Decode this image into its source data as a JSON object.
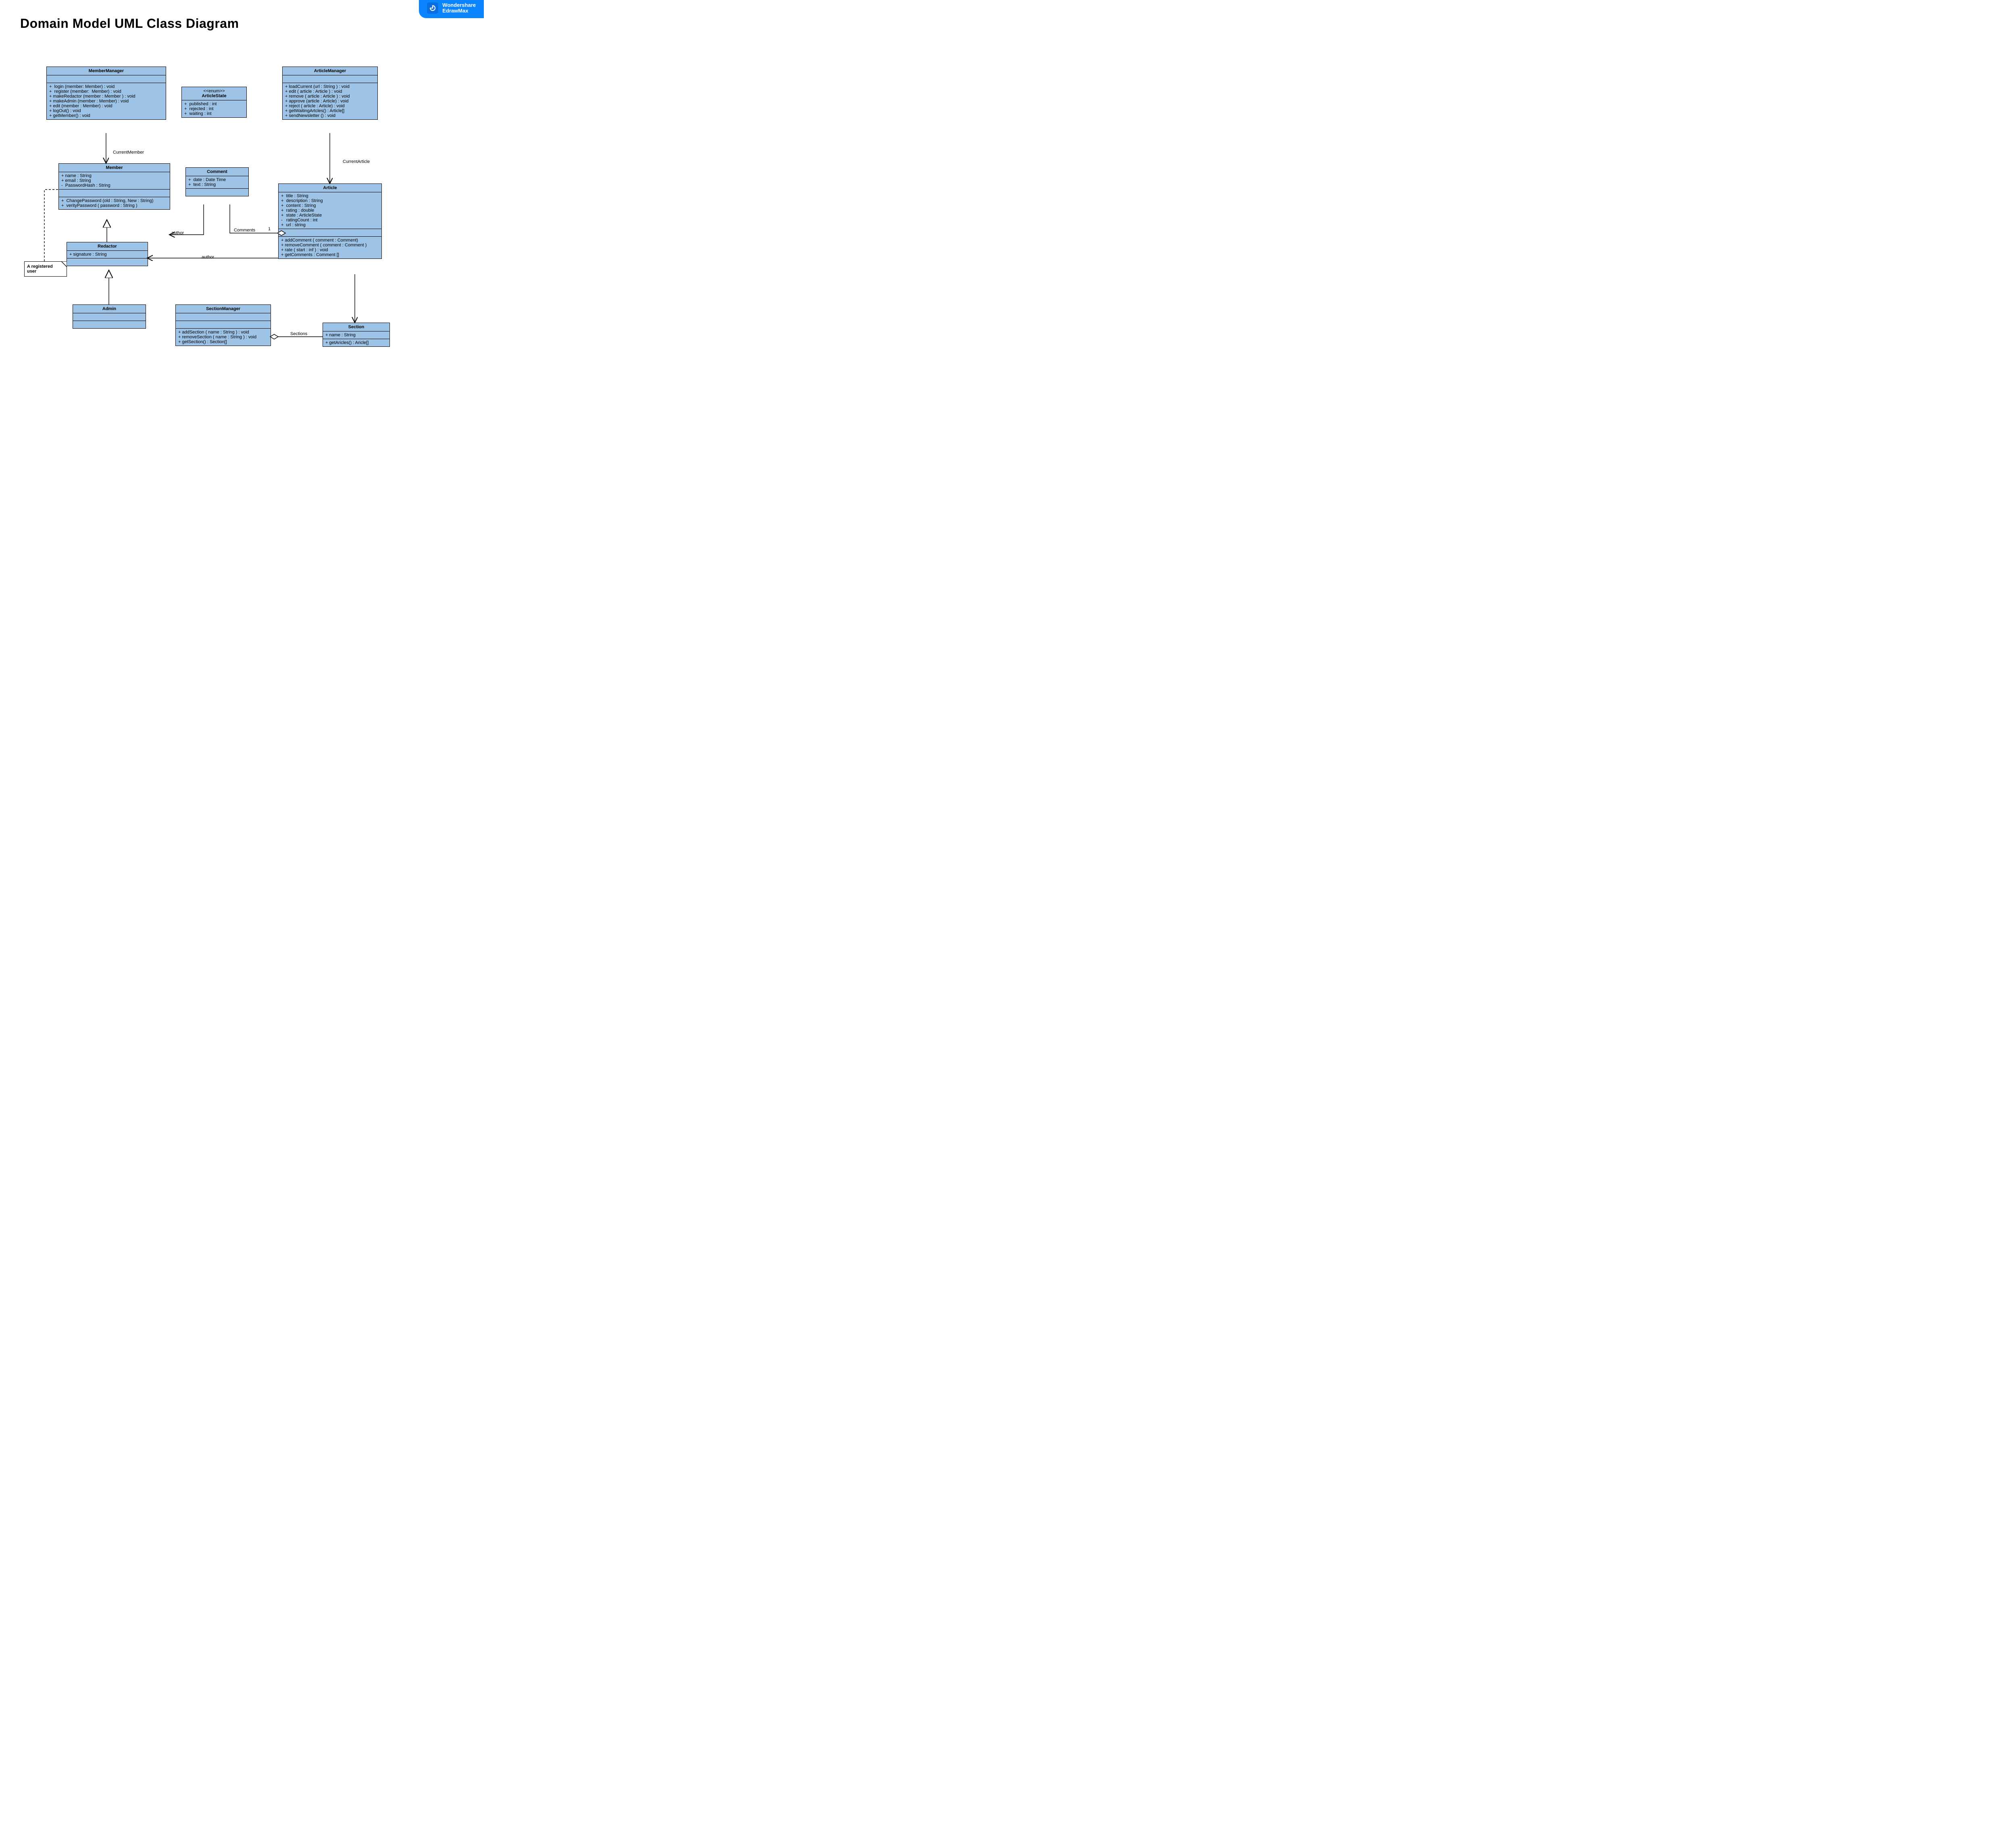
{
  "title": "Domain Model UML Class Diagram",
  "brand": {
    "line1": "Wondershare",
    "line2": "EdrawMax"
  },
  "note": {
    "text": "A registered user"
  },
  "labels": {
    "currentMember": "CurrentMember",
    "currentArticle": "CurrentArticle",
    "author1": "author",
    "author2": "author",
    "comments": "Comments",
    "one": "1",
    "sections": "Sections"
  },
  "classes": {
    "memberManager": {
      "name": "MemberManager",
      "attrs": [],
      "ops": [
        "+  login (member: Member) : void",
        "+  register (member:  Member) : void",
        "+ makeRedactor (member : Member ) : void",
        "+ makeAdmin (member : Member) : void",
        "+ edit (member : Member) : void",
        "+ logOut() : void",
        "+ getMember() : void"
      ]
    },
    "articleState": {
      "stereo": "<<enum>>",
      "name": "ArticleState",
      "attrs": [
        "+  published : int",
        "+  rejected : int",
        "+  waiting : int"
      ]
    },
    "articleManager": {
      "name": "ArticleManager",
      "attrs": [],
      "ops": [
        "+ loadCurrent (url : String ) : void",
        "+ edit ( article : Article ) : void",
        "+ remove ( article : Article ) : void",
        "+ approve (article : Article) : void",
        "+ reject ( article : Article) : void",
        "+ getWaitingArtcles() : Article[]",
        "+ sendNewsletter () : void"
      ]
    },
    "member": {
      "name": "Member",
      "attrs": [
        "+ name : String",
        "+ email : String",
        "-  PasswordHash : String"
      ],
      "ops": [
        "+  ChangePassword (old : String, New : String)",
        "+  verityPassword ( password : String )"
      ]
    },
    "comment": {
      "name": "Comment",
      "attrs": [
        "+  date : Date Time",
        "+  text : String"
      ]
    },
    "article": {
      "name": "Article",
      "attrs": [
        "+  title : String",
        "+  description : String",
        "+  content : String",
        "+  rating : double",
        "+  state : ArticleState",
        "-   ratingCount : int",
        "+  url : string"
      ],
      "ops": [
        "+ addComment ( comment : Comment)",
        "+ removeComment ( comment : Comment )",
        "+ rate ( start : inf ) : void",
        "+ getComments : Comment []"
      ]
    },
    "redactor": {
      "name": "Redactor",
      "attrs": [
        "+ signature : String"
      ]
    },
    "admin": {
      "name": "Admin"
    },
    "sectionManager": {
      "name": "SectionManager",
      "attrs": [],
      "ops": [
        "+ addSection ( name : String ) : void",
        "+ removeSection ( name : String ) : void",
        "+ getSection() : Section[]"
      ]
    },
    "section": {
      "name": "Section",
      "attrs": [
        "+ name : String"
      ],
      "ops": [
        "+ getAricles() : Aricle[]"
      ]
    }
  }
}
